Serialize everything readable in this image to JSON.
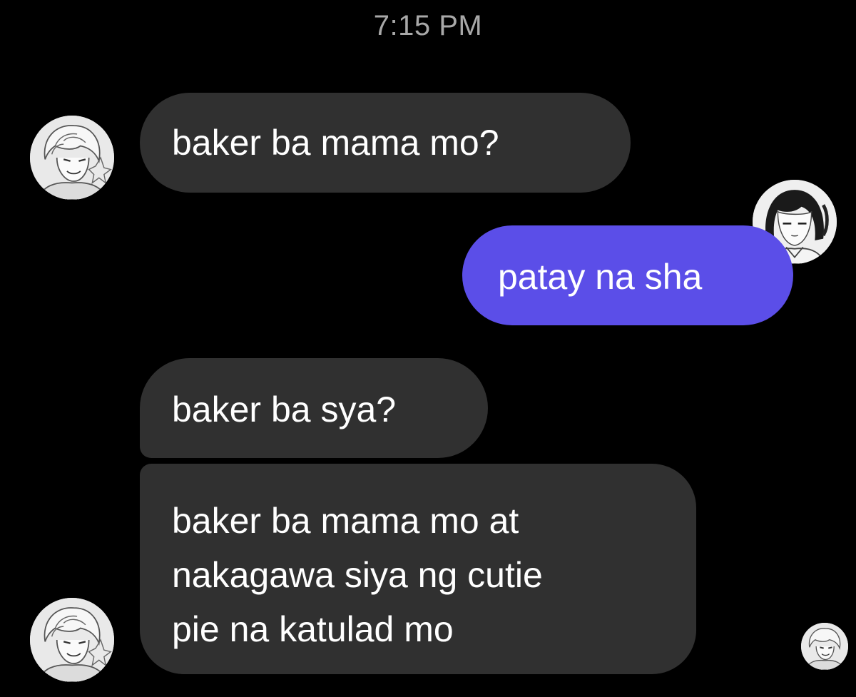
{
  "timestamp": "7:15 PM",
  "messages": [
    {
      "sender": "incoming",
      "lines": [
        "baker ba mama mo?"
      ]
    },
    {
      "sender": "outgoing",
      "lines": [
        "patay na sha"
      ]
    },
    {
      "sender": "incoming",
      "lines": [
        "baker ba sya?"
      ]
    },
    {
      "sender": "incoming",
      "lines": [
        "baker ba mama mo at",
        "nakagawa siya ng cutie",
        "pie na katulad mo"
      ]
    }
  ],
  "colors": {
    "background": "#000000",
    "incoming_bubble": "#303030",
    "outgoing_bubble": "#5b4ee8",
    "timestamp_text": "#a8a8a8",
    "message_text": "#ffffff"
  },
  "avatars": [
    {
      "name": "contact-avatar-icon"
    },
    {
      "name": "user-avatar-icon"
    },
    {
      "name": "contact-avatar-icon"
    },
    {
      "name": "seen-receipt-avatar-icon"
    }
  ]
}
